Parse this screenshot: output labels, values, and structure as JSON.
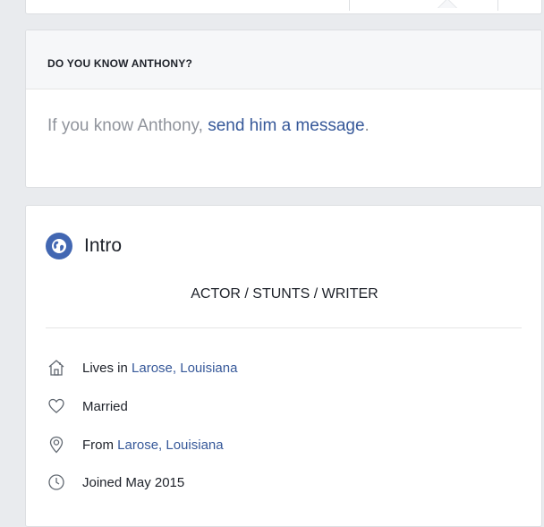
{
  "know_card": {
    "title": "DO YOU KNOW ANTHONY?",
    "body_prefix": "If you know Anthony, ",
    "link_text": "send him a message",
    "body_suffix": "."
  },
  "intro": {
    "icon": "globe-icon",
    "title": "Intro",
    "bio": "ACTOR / STUNTS / WRITER",
    "items": [
      {
        "icon": "home-icon",
        "prefix": "Lives in ",
        "link": "Larose, Louisiana"
      },
      {
        "icon": "heart-icon",
        "text": "Married"
      },
      {
        "icon": "location-pin-icon",
        "prefix": "From ",
        "link": "Larose, Louisiana"
      },
      {
        "icon": "clock-icon",
        "text": "Joined May 2015"
      }
    ]
  },
  "colors": {
    "link": "#365899",
    "accent": "#4267b2",
    "background": "#e9ebee"
  }
}
